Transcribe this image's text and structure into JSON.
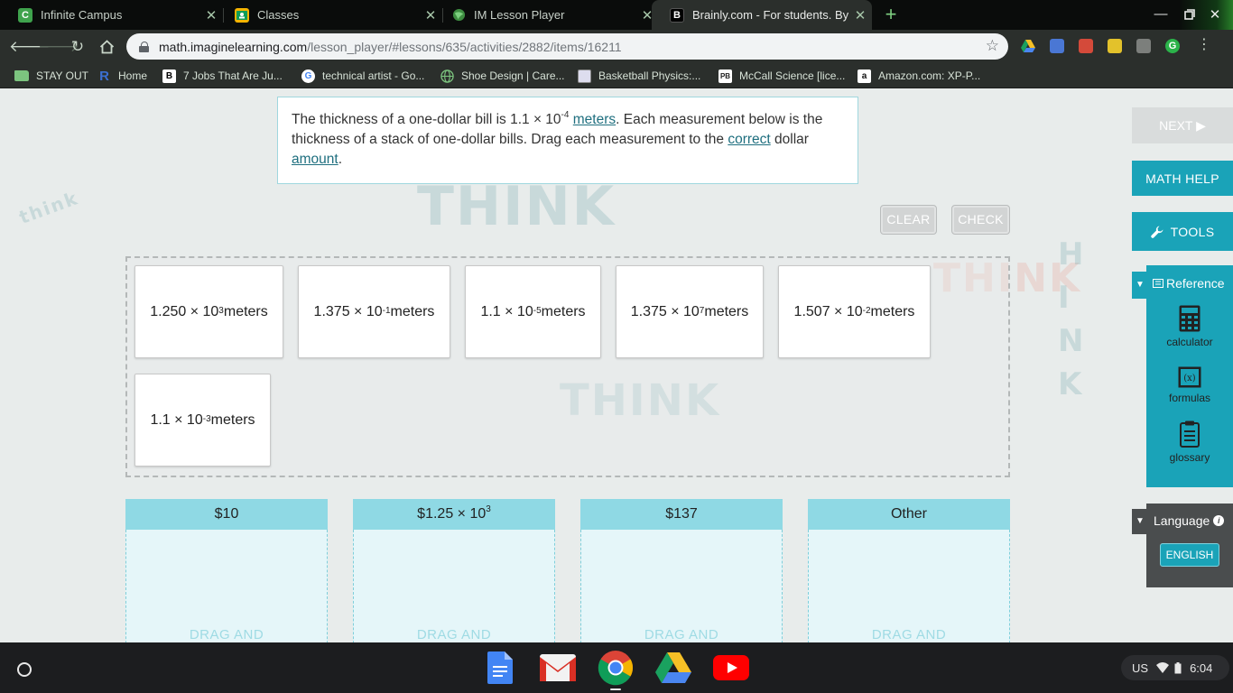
{
  "browser": {
    "tabs": [
      {
        "title": "Infinite Campus",
        "icon": "infinite-campus-icon",
        "color": "#3fa34d",
        "glyph": "C",
        "active": false
      },
      {
        "title": "Classes",
        "icon": "google-classroom-icon",
        "color": "#f4b400",
        "glyph": "",
        "active": false
      },
      {
        "title": "IM Lesson Player",
        "icon": "globe-icon",
        "color": "#3e8e41",
        "glyph": "",
        "active": false
      },
      {
        "title": "Brainly.com - For students. By st",
        "icon": "brainly-icon",
        "color": "#000000",
        "glyph": "B",
        "active": true
      }
    ],
    "url_host": "math.imaginelearning.com",
    "url_path": "/lesson_player/#lessons/635/activities/2882/items/16211",
    "bookmarks": [
      {
        "label": "STAY OUT",
        "icon": "folder-icon"
      },
      {
        "label": "Home",
        "icon": "renaissance-icon"
      },
      {
        "label": "7 Jobs That Are Ju...",
        "icon": "b-icon"
      },
      {
        "label": "technical artist - Go...",
        "icon": "google-icon"
      },
      {
        "label": "Shoe Design | Care...",
        "icon": "globe-icon"
      },
      {
        "label": "Basketball Physics:...",
        "icon": "site-icon"
      },
      {
        "label": "McCall Science [lice...",
        "icon": "pb-icon"
      },
      {
        "label": "Amazon.com: XP-P...",
        "icon": "amazon-icon"
      }
    ]
  },
  "question": {
    "part1": "The thickness of a one-dollar bill is 1.1 × 10",
    "exp": "-4",
    "link1": "meters",
    "part2": ". Each measurement below is the thickness of a stack of one-dollar bills. Drag each measurement to the ",
    "link2": "correct",
    "part3": " dollar ",
    "link3": "amount",
    "part4": "."
  },
  "buttons": {
    "clear": "CLEAR",
    "check": "CHECK",
    "next": "NEXT ▶",
    "math_help": "MATH HELP",
    "tools": "TOOLS"
  },
  "cards": [
    {
      "base": "1.250 × 10",
      "exp": "3",
      "unit": " meters"
    },
    {
      "base": "1.375 × 10",
      "exp": "-1",
      "unit": " meters"
    },
    {
      "base": "1.1 × 10",
      "exp": "-5",
      "unit": " meters"
    },
    {
      "base": "1.375 × 10",
      "exp": "7",
      "unit": " meters"
    },
    {
      "base": "1.507 × 10",
      "exp": "-2",
      "unit": " meters"
    },
    {
      "base": "1.1 × 10",
      "exp": "-3",
      "unit": " meters"
    }
  ],
  "bins": [
    {
      "base": "$10",
      "exp": ""
    },
    {
      "base": "$1.25 × 10",
      "exp": "3"
    },
    {
      "base": "$137",
      "exp": ""
    },
    {
      "base": "Other",
      "exp": ""
    }
  ],
  "bin_hint": "DRAG AND",
  "reference": {
    "header": "Reference",
    "items": [
      "calculator",
      "formulas",
      "glossary"
    ]
  },
  "language": {
    "header": "Language",
    "current": "ENGLISH"
  },
  "system_tray": {
    "locale": "US",
    "time": "6:04"
  },
  "colors": {
    "accent": "#1aa3b8",
    "bin_header": "#8fd9e4"
  }
}
